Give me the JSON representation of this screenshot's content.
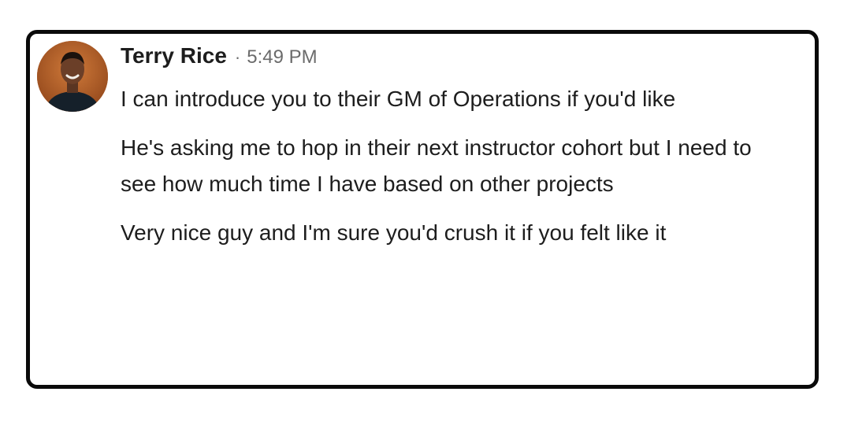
{
  "message_group": {
    "sender": "Terry Rice",
    "separator": "·",
    "time": "5:49 PM",
    "avatar": "profile-photo-icon",
    "messages": [
      "I can introduce you to their GM of Operations if you'd like",
      "He's asking me to hop in their next instructor cohort but I need to see how much time I have based on other projects",
      "Very nice guy and I'm sure you'd crush it if you felt like it"
    ]
  },
  "colors": {
    "text": "#1d1d1d",
    "muted": "#6b6b6b",
    "border": "#0a0a0a",
    "avatar_bg": "#b7622a"
  }
}
